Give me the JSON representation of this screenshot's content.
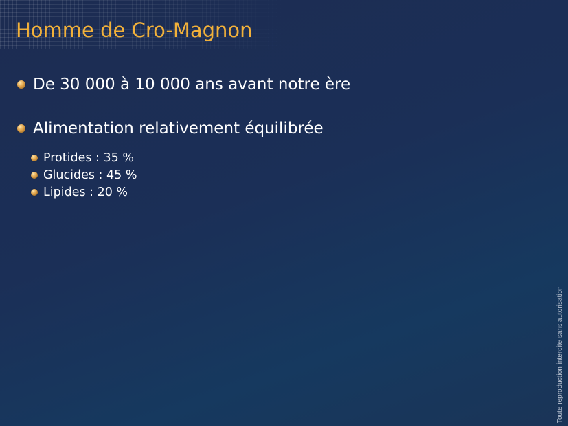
{
  "slide": {
    "title": "Homme de Cro-Magnon",
    "bullets": [
      {
        "text": "De 30 000 à 10 000 ans avant notre ère"
      },
      {
        "text": "Alimentation relativement équilibrée",
        "subitems": [
          "Protides : 35 %",
          "Glucides : 45 %",
          "Lipides : 20 %"
        ]
      }
    ],
    "copyright": "Toute reproduction interdite sans autorisation"
  },
  "colors": {
    "title": "#f2b13a",
    "text": "#ffffff",
    "background": "#1b2f57",
    "bullet": "#e0a34a"
  },
  "icons": {
    "bullet": "bullet-dot-icon"
  }
}
